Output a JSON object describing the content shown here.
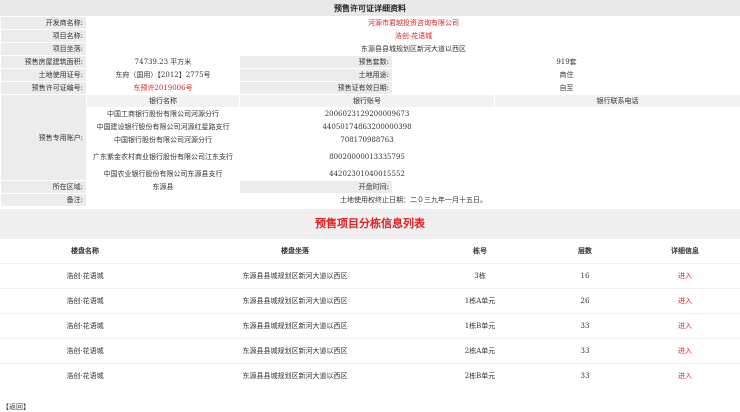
{
  "page_title": "预售许可证详细资料",
  "detail": {
    "developer_label": "开发商名称:",
    "developer_value": "河源市君越投资咨询有限公司",
    "project_label": "项目名称:",
    "project_value": "浩创·花语城",
    "location_label": "项目坐落:",
    "location_value": "东源县县城规划区新河大道以西区",
    "area_label": "预售房屋建筑面积:",
    "area_value": "74739.23 平方米",
    "units_label": "预售套数:",
    "units_value": "919套",
    "landcert_label": "土地使用证号:",
    "landcert_value": "东府（国用）【2012】2775号",
    "landuse_label": "土地用途:",
    "landuse_value": "商住",
    "permit_label": "预售许可证编号:",
    "permit_value": "东预许2019006号",
    "issuer_label": "预售证有效日期:",
    "issuer_value": "自至",
    "account_label": "预售专用账户:",
    "bank_headers": [
      "银行名称",
      "银行账号",
      "银行联系电话"
    ],
    "banks": [
      {
        "name": "中国工商银行股份有限公司河源分行",
        "account": "2006023129200009673",
        "phone": ""
      },
      {
        "name": "中国建设银行股份有限公司河源红星路支行",
        "account": "44050174863200000398",
        "phone": ""
      },
      {
        "name": "中国银行股份有限公司河源分行",
        "account": "708170988763",
        "phone": ""
      },
      {
        "name": "广东紫金农村商业银行股份有限公司江东支行",
        "account": "80020000013335795",
        "phone": ""
      },
      {
        "name": "中国农业银行股份有限公司东源县支行",
        "account": "44202301040015552",
        "phone": ""
      }
    ],
    "district_label": "所在区域:",
    "district_value": "东源县",
    "opening_label": "开盘时间:",
    "opening_value": "",
    "remark_label": "备注:",
    "remark_value": "土地使用权终止日期：二０三九年一月十五日。"
  },
  "section_title": "预售项目分栋信息列表",
  "buildings": {
    "headers": [
      "楼盘名称",
      "楼盘坐落",
      "栋号",
      "层数",
      "详细信息"
    ],
    "rows": [
      {
        "name": "浩创·花语城",
        "location": "东源县县城规划区新河大道以西区",
        "no": "3栋",
        "floors": "16",
        "link": "进入"
      },
      {
        "name": "浩创·花语城",
        "location": "东源县县城规划区新河大道以西区",
        "no": "1栋A单元",
        "floors": "26",
        "link": "进入"
      },
      {
        "name": "浩创·花语城",
        "location": "东源县县城规划区新河大道以西区",
        "no": "1栋B单元",
        "floors": "33",
        "link": "进入"
      },
      {
        "name": "浩创·花语城",
        "location": "东源县县城规划区新河大道以西区",
        "no": "2栋A单元",
        "floors": "33",
        "link": "进入"
      },
      {
        "name": "浩创·花语城",
        "location": "东源县县城规划区新河大道以西区",
        "no": "2栋B单元",
        "floors": "33",
        "link": "进入"
      }
    ]
  },
  "back_label": "【返回】"
}
